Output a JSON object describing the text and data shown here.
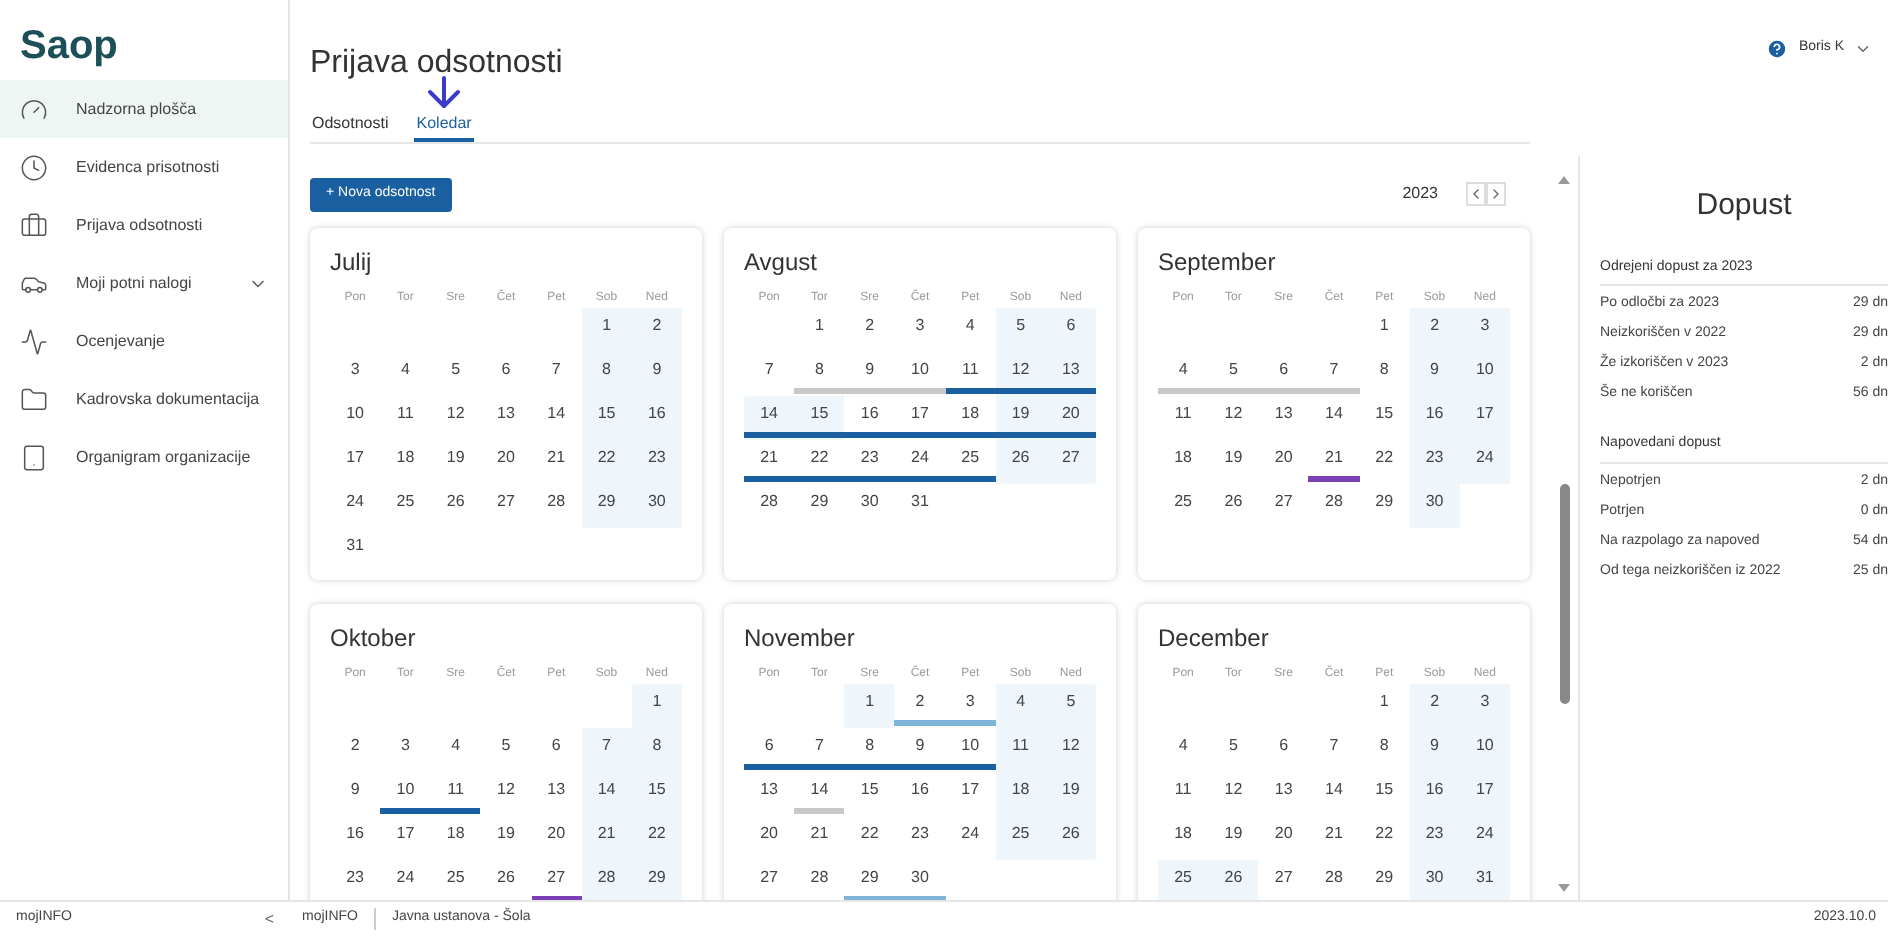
{
  "logo": "Saop",
  "sidebar": {
    "items": [
      {
        "label": "Nadzorna plošča",
        "kind": "gauge",
        "selected": true,
        "expandable": false
      },
      {
        "label": "Evidenca prisotnosti",
        "kind": "clock",
        "selected": false,
        "expandable": false
      },
      {
        "label": "Prijava odsotnosti",
        "kind": "briefcase",
        "selected": false,
        "expandable": false
      },
      {
        "label": "Moji potni nalogi",
        "kind": "car",
        "selected": false,
        "expandable": true
      },
      {
        "label": "Ocenjevanje",
        "kind": "trend",
        "selected": false,
        "expandable": false
      },
      {
        "label": "Kadrovska dokumentacija",
        "kind": "folder",
        "selected": false,
        "expandable": false
      },
      {
        "label": "Organigram organizacije",
        "kind": "device",
        "selected": false,
        "expandable": false
      }
    ],
    "footer": {
      "label": "mojINFO",
      "collapse": "<"
    }
  },
  "header": {
    "title": "Prijava odsotnosti",
    "user": "Boris K"
  },
  "tabs": [
    {
      "label": "Odsotnosti",
      "selected": false
    },
    {
      "label": "Koledar",
      "selected": true
    }
  ],
  "toolbar": {
    "button": "+ Nova odsotnost",
    "year": "2023"
  },
  "months": [
    {
      "name": "Julij",
      "weekdays": [
        "Pon",
        "Tor",
        "Sre",
        "Čet",
        "Pet",
        "Sob",
        "Ned"
      ],
      "weeks": [
        {
          "kind": "first",
          "days": [
            {
              "day": "1",
              "shaded": true
            },
            {
              "day": "2",
              "shaded": true
            }
          ]
        },
        {
          "kind": "week",
          "days": [
            {
              "day": "3",
              "shaded": false
            },
            {
              "day": "4",
              "shaded": false
            },
            {
              "day": "5",
              "shaded": false
            },
            {
              "day": "6",
              "shaded": false
            },
            {
              "day": "7",
              "shaded": false
            },
            {
              "day": "8",
              "shaded": true
            },
            {
              "day": "9",
              "shaded": true
            }
          ]
        },
        {
          "kind": "week",
          "days": [
            {
              "day": "10",
              "shaded": false
            },
            {
              "day": "11",
              "shaded": false
            },
            {
              "day": "12",
              "shaded": false
            },
            {
              "day": "13",
              "shaded": false
            },
            {
              "day": "14",
              "shaded": false
            },
            {
              "day": "15",
              "shaded": true
            },
            {
              "day": "16",
              "shaded": true
            }
          ]
        },
        {
          "kind": "week",
          "days": [
            {
              "day": "17",
              "shaded": false
            },
            {
              "day": "18",
              "shaded": false
            },
            {
              "day": "19",
              "shaded": false
            },
            {
              "day": "20",
              "shaded": false
            },
            {
              "day": "21",
              "shaded": false
            },
            {
              "day": "22",
              "shaded": true
            },
            {
              "day": "23",
              "shaded": true
            }
          ]
        },
        {
          "kind": "week",
          "days": [
            {
              "day": "24",
              "shaded": false
            },
            {
              "day": "25",
              "shaded": false
            },
            {
              "day": "26",
              "shaded": false
            },
            {
              "day": "27",
              "shaded": false
            },
            {
              "day": "28",
              "shaded": false
            },
            {
              "day": "29",
              "shaded": true
            },
            {
              "day": "30",
              "shaded": true
            }
          ]
        },
        {
          "kind": "week",
          "days": [
            {
              "day": "31",
              "shaded": false
            }
          ]
        }
      ]
    },
    {
      "name": "Avgust",
      "weekdays": [
        "Pon",
        "Tor",
        "Sre",
        "Čet",
        "Pet",
        "Sob",
        "Ned"
      ],
      "weeks": [
        {
          "kind": "first",
          "days": [
            {
              "day": "1",
              "shaded": false
            },
            {
              "day": "2",
              "shaded": false
            },
            {
              "day": "3",
              "shaded": false
            },
            {
              "day": "4",
              "shaded": false
            },
            {
              "day": "5",
              "shaded": true
            },
            {
              "day": "6",
              "shaded": true
            }
          ]
        },
        {
          "kind": "week",
          "days": [
            {
              "day": "7",
              "shaded": false
            },
            {
              "day": "8",
              "shaded": false,
              "color": "#c8c8c8"
            },
            {
              "day": "9",
              "shaded": false,
              "color": "#c8c8c8"
            },
            {
              "day": "10",
              "shaded": false,
              "color": "#c8c8c8"
            },
            {
              "day": "11",
              "shaded": false,
              "color": "#1a5fa0"
            },
            {
              "day": "12",
              "shaded": true,
              "color": "#1a5fa0"
            },
            {
              "day": "13",
              "shaded": true,
              "color": "#1a5fa0"
            }
          ]
        },
        {
          "kind": "week",
          "days": [
            {
              "day": "14",
              "shaded": true,
              "color": "#1a5fa0"
            },
            {
              "day": "15",
              "shaded": true,
              "color": "#1a5fa0"
            },
            {
              "day": "16",
              "shaded": false,
              "color": "#1a5fa0"
            },
            {
              "day": "17",
              "shaded": false,
              "color": "#1a5fa0"
            },
            {
              "day": "18",
              "shaded": false,
              "color": "#1a5fa0"
            },
            {
              "day": "19",
              "shaded": true,
              "color": "#1a5fa0"
            },
            {
              "day": "20",
              "shaded": true,
              "color": "#1a5fa0"
            }
          ]
        },
        {
          "kind": "week",
          "days": [
            {
              "day": "21",
              "shaded": false,
              "color": "#1a5fa0"
            },
            {
              "day": "22",
              "shaded": false,
              "color": "#1a5fa0"
            },
            {
              "day": "23",
              "shaded": false,
              "color": "#1a5fa0"
            },
            {
              "day": "24",
              "shaded": false,
              "color": "#1a5fa0"
            },
            {
              "day": "25",
              "shaded": false,
              "color": "#1a5fa0"
            },
            {
              "day": "26",
              "shaded": true
            },
            {
              "day": "27",
              "shaded": true
            }
          ]
        },
        {
          "kind": "week",
          "days": [
            {
              "day": "28",
              "shaded": false
            },
            {
              "day": "29",
              "shaded": false
            },
            {
              "day": "30",
              "shaded": false
            },
            {
              "day": "31",
              "shaded": false
            }
          ]
        }
      ]
    },
    {
      "name": "September",
      "weekdays": [
        "Pon",
        "Tor",
        "Sre",
        "Čet",
        "Pet",
        "Sob",
        "Ned"
      ],
      "weeks": [
        {
          "kind": "first",
          "days": [
            {
              "day": "1",
              "shaded": false
            },
            {
              "day": "2",
              "shaded": true
            },
            {
              "day": "3",
              "shaded": true
            }
          ]
        },
        {
          "kind": "week",
          "days": [
            {
              "day": "4",
              "shaded": false,
              "color": "#c8c8c8"
            },
            {
              "day": "5",
              "shaded": false,
              "color": "#c8c8c8"
            },
            {
              "day": "6",
              "shaded": false,
              "color": "#c8c8c8"
            },
            {
              "day": "7",
              "shaded": false,
              "color": "#c8c8c8"
            },
            {
              "day": "8",
              "shaded": false
            },
            {
              "day": "9",
              "shaded": true
            },
            {
              "day": "10",
              "shaded": true
            }
          ]
        },
        {
          "kind": "week",
          "days": [
            {
              "day": "11",
              "shaded": false
            },
            {
              "day": "12",
              "shaded": false
            },
            {
              "day": "13",
              "shaded": false
            },
            {
              "day": "14",
              "shaded": false
            },
            {
              "day": "15",
              "shaded": false
            },
            {
              "day": "16",
              "shaded": true
            },
            {
              "day": "17",
              "shaded": true
            }
          ]
        },
        {
          "kind": "week",
          "days": [
            {
              "day": "18",
              "shaded": false
            },
            {
              "day": "19",
              "shaded": false
            },
            {
              "day": "20",
              "shaded": false
            },
            {
              "day": "21",
              "shaded": false,
              "color": "#7b3fb5"
            },
            {
              "day": "22",
              "shaded": false
            },
            {
              "day": "23",
              "shaded": true
            },
            {
              "day": "24",
              "shaded": true
            }
          ]
        },
        {
          "kind": "week",
          "days": [
            {
              "day": "25",
              "shaded": false
            },
            {
              "day": "26",
              "shaded": false
            },
            {
              "day": "27",
              "shaded": false
            },
            {
              "day": "28",
              "shaded": false
            },
            {
              "day": "29",
              "shaded": false
            },
            {
              "day": "30",
              "shaded": true
            }
          ]
        }
      ]
    },
    {
      "name": "Oktober",
      "weekdays": [
        "Pon",
        "Tor",
        "Sre",
        "Čet",
        "Pet",
        "Sob",
        "Ned"
      ],
      "weeks": [
        {
          "kind": "first",
          "days": [
            {
              "day": "1",
              "shaded": true
            }
          ]
        },
        {
          "kind": "week",
          "days": [
            {
              "day": "2",
              "shaded": false
            },
            {
              "day": "3",
              "shaded": false
            },
            {
              "day": "4",
              "shaded": false
            },
            {
              "day": "5",
              "shaded": false
            },
            {
              "day": "6",
              "shaded": false
            },
            {
              "day": "7",
              "shaded": true
            },
            {
              "day": "8",
              "shaded": true
            }
          ]
        },
        {
          "kind": "week",
          "days": [
            {
              "day": "9",
              "shaded": false
            },
            {
              "day": "10",
              "shaded": false,
              "color": "#1a5fa0"
            },
            {
              "day": "11",
              "shaded": false,
              "color": "#1a5fa0"
            },
            {
              "day": "12",
              "shaded": false
            },
            {
              "day": "13",
              "shaded": false
            },
            {
              "day": "14",
              "shaded": true
            },
            {
              "day": "15",
              "shaded": true
            }
          ]
        },
        {
          "kind": "week",
          "days": [
            {
              "day": "16",
              "shaded": false
            },
            {
              "day": "17",
              "shaded": false
            },
            {
              "day": "18",
              "shaded": false
            },
            {
              "day": "19",
              "shaded": false
            },
            {
              "day": "20",
              "shaded": false
            },
            {
              "day": "21",
              "shaded": true
            },
            {
              "day": "22",
              "shaded": true
            }
          ]
        },
        {
          "kind": "week",
          "days": [
            {
              "day": "23",
              "shaded": false
            },
            {
              "day": "24",
              "shaded": false
            },
            {
              "day": "25",
              "shaded": false
            },
            {
              "day": "26",
              "shaded": false
            },
            {
              "day": "27",
              "shaded": false,
              "color": "#7b3fb5"
            },
            {
              "day": "28",
              "shaded": true
            },
            {
              "day": "29",
              "shaded": true
            }
          ]
        }
      ]
    },
    {
      "name": "November",
      "weekdays": [
        "Pon",
        "Tor",
        "Sre",
        "Čet",
        "Pet",
        "Sob",
        "Ned"
      ],
      "weeks": [
        {
          "kind": "first",
          "days": [
            {
              "day": "1",
              "shaded": true
            },
            {
              "day": "2",
              "shaded": false,
              "color": "#7fb3d9"
            },
            {
              "day": "3",
              "shaded": false,
              "color": "#7fb3d9"
            },
            {
              "day": "4",
              "shaded": true
            },
            {
              "day": "5",
              "shaded": true
            }
          ]
        },
        {
          "kind": "week",
          "days": [
            {
              "day": "6",
              "shaded": false,
              "color": "#1a5fa0"
            },
            {
              "day": "7",
              "shaded": false,
              "color": "#1a5fa0"
            },
            {
              "day": "8",
              "shaded": false,
              "color": "#1a5fa0"
            },
            {
              "day": "9",
              "shaded": false,
              "color": "#1a5fa0"
            },
            {
              "day": "10",
              "shaded": false,
              "color": "#1a5fa0"
            },
            {
              "day": "11",
              "shaded": true
            },
            {
              "day": "12",
              "shaded": true
            }
          ]
        },
        {
          "kind": "week",
          "days": [
            {
              "day": "13",
              "shaded": false
            },
            {
              "day": "14",
              "shaded": false,
              "color": "#c8c8c8"
            },
            {
              "day": "15",
              "shaded": false
            },
            {
              "day": "16",
              "shaded": false
            },
            {
              "day": "17",
              "shaded": false
            },
            {
              "day": "18",
              "shaded": true
            },
            {
              "day": "19",
              "shaded": true
            }
          ]
        },
        {
          "kind": "week",
          "days": [
            {
              "day": "20",
              "shaded": false
            },
            {
              "day": "21",
              "shaded": false
            },
            {
              "day": "22",
              "shaded": false
            },
            {
              "day": "23",
              "shaded": false
            },
            {
              "day": "24",
              "shaded": false
            },
            {
              "day": "25",
              "shaded": true
            },
            {
              "day": "26",
              "shaded": true
            }
          ]
        },
        {
          "kind": "week",
          "days": [
            {
              "day": "27",
              "shaded": false
            },
            {
              "day": "28",
              "shaded": false
            },
            {
              "day": "29",
              "shaded": false,
              "color": "#7fb3d9"
            },
            {
              "day": "30",
              "shaded": false,
              "color": "#7fb3d9"
            }
          ]
        }
      ]
    },
    {
      "name": "December",
      "weekdays": [
        "Pon",
        "Tor",
        "Sre",
        "Čet",
        "Pet",
        "Sob",
        "Ned"
      ],
      "weeks": [
        {
          "kind": "first",
          "days": [
            {
              "day": "1",
              "shaded": false
            },
            {
              "day": "2",
              "shaded": true
            },
            {
              "day": "3",
              "shaded": true
            }
          ]
        },
        {
          "kind": "week",
          "days": [
            {
              "day": "4",
              "shaded": false
            },
            {
              "day": "5",
              "shaded": false
            },
            {
              "day": "6",
              "shaded": false
            },
            {
              "day": "7",
              "shaded": false
            },
            {
              "day": "8",
              "shaded": false
            },
            {
              "day": "9",
              "shaded": true
            },
            {
              "day": "10",
              "shaded": true
            }
          ]
        },
        {
          "kind": "week",
          "days": [
            {
              "day": "11",
              "shaded": false
            },
            {
              "day": "12",
              "shaded": false
            },
            {
              "day": "13",
              "shaded": false
            },
            {
              "day": "14",
              "shaded": false
            },
            {
              "day": "15",
              "shaded": false
            },
            {
              "day": "16",
              "shaded": true
            },
            {
              "day": "17",
              "shaded": true
            }
          ]
        },
        {
          "kind": "week",
          "days": [
            {
              "day": "18",
              "shaded": false
            },
            {
              "day": "19",
              "shaded": false
            },
            {
              "day": "20",
              "shaded": false
            },
            {
              "day": "21",
              "shaded": false
            },
            {
              "day": "22",
              "shaded": false
            },
            {
              "day": "23",
              "shaded": true
            },
            {
              "day": "24",
              "shaded": true
            }
          ]
        },
        {
          "kind": "week",
          "days": [
            {
              "day": "25",
              "shaded": true
            },
            {
              "day": "26",
              "shaded": true
            },
            {
              "day": "27",
              "shaded": false
            },
            {
              "day": "28",
              "shaded": false
            },
            {
              "day": "29",
              "shaded": false
            },
            {
              "day": "30",
              "shaded": true
            },
            {
              "day": "31",
              "shaded": true
            }
          ]
        }
      ]
    }
  ],
  "panel": {
    "title": "Dopust",
    "sections": [
      {
        "heading": "Odrejeni dopust za 2023",
        "rows": [
          {
            "label": "Po odločbi za 2023",
            "value": "29 dn"
          },
          {
            "label": "Neizkoriščen v 2022",
            "value": "29 dn"
          },
          {
            "label": "Že izkoriščen v 2023",
            "value": "2 dn"
          },
          {
            "label": "Še ne koriščen",
            "value": "56 dn"
          }
        ]
      },
      {
        "heading": "Napovedani dopust",
        "rows": [
          {
            "label": "Nepotrjen",
            "value": "2 dn"
          },
          {
            "label": "Potrjen",
            "value": "0 dn"
          },
          {
            "label": "Na razpolago za napoved",
            "value": "54 dn"
          },
          {
            "label": "Od tega neizkoriščen iz 2022",
            "value": "25 dn"
          }
        ]
      }
    ]
  },
  "footer": {
    "app": "mojINFO",
    "organization": "Javna ustanova - Šola",
    "version": "2023.10.0"
  }
}
